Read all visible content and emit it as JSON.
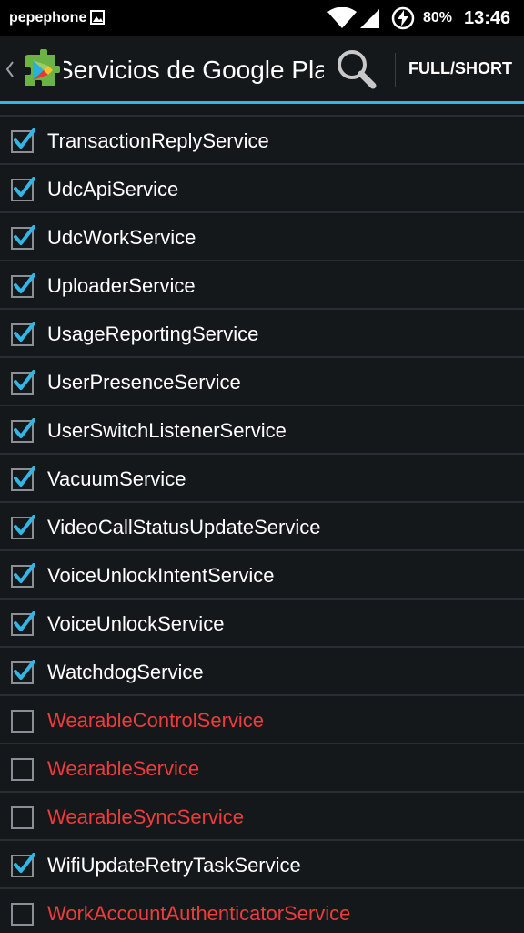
{
  "status_bar": {
    "carrier": "pepephone",
    "battery": "80%",
    "time": "13:46",
    "icons": [
      "image-icon",
      "wifi-icon",
      "signal-icon",
      "battery-charging-icon"
    ]
  },
  "action_bar": {
    "title": "Servicios de Google Play",
    "full_short_label": "FULL/SHORT",
    "icons": [
      "back-caret-icon",
      "google-play-services-icon",
      "search-icon"
    ]
  },
  "colors": {
    "accent": "#33b5e5",
    "enabled_text": "#ffffff",
    "disabled_text": "#ee3b3b",
    "background": "#15181b"
  },
  "services": [
    {
      "name": "TransactionReplyService",
      "enabled": true
    },
    {
      "name": "UdcApiService",
      "enabled": true
    },
    {
      "name": "UdcWorkService",
      "enabled": true
    },
    {
      "name": "UploaderService",
      "enabled": true
    },
    {
      "name": "UsageReportingService",
      "enabled": true
    },
    {
      "name": "UserPresenceService",
      "enabled": true
    },
    {
      "name": "UserSwitchListenerService",
      "enabled": true
    },
    {
      "name": "VacuumService",
      "enabled": true
    },
    {
      "name": "VideoCallStatusUpdateService",
      "enabled": true
    },
    {
      "name": "VoiceUnlockIntentService",
      "enabled": true
    },
    {
      "name": "VoiceUnlockService",
      "enabled": true
    },
    {
      "name": "WatchdogService",
      "enabled": true
    },
    {
      "name": "WearableControlService",
      "enabled": false
    },
    {
      "name": "WearableService",
      "enabled": false
    },
    {
      "name": "WearableSyncService",
      "enabled": false
    },
    {
      "name": "WifiUpdateRetryTaskService",
      "enabled": true
    },
    {
      "name": "WorkAccountAuthenticatorService",
      "enabled": false
    }
  ]
}
